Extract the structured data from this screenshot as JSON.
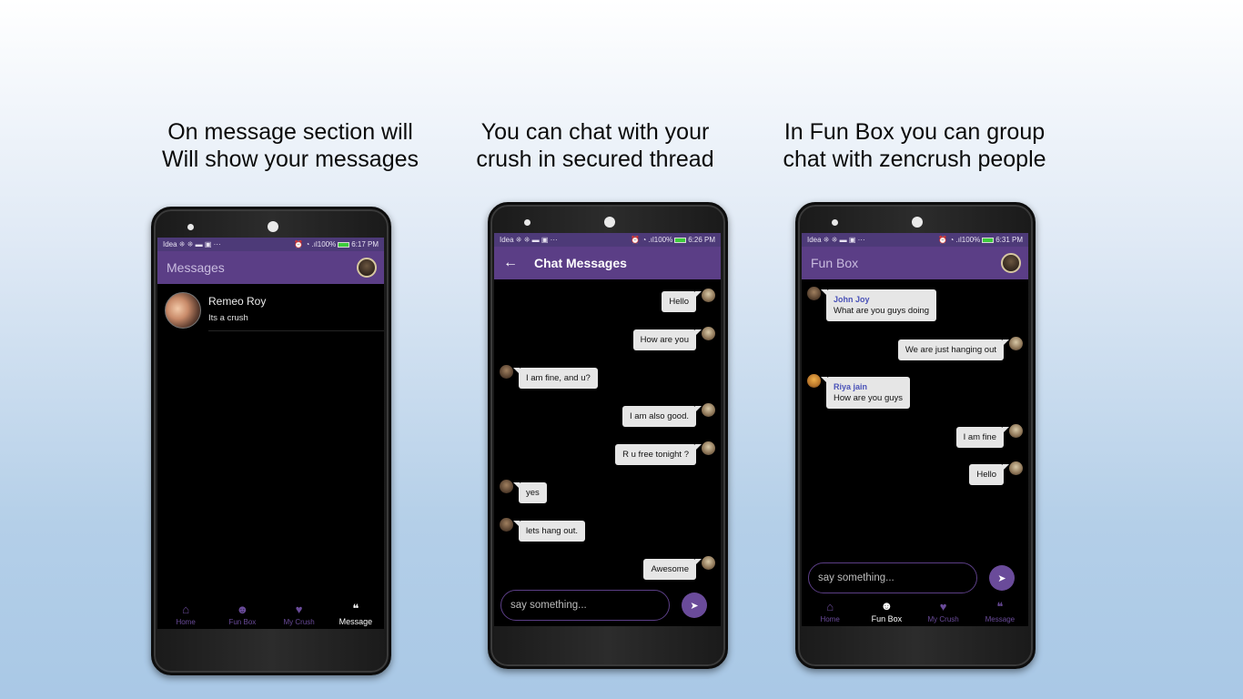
{
  "captions": [
    {
      "line1": "On message section will",
      "line2": "Will show your messages"
    },
    {
      "line1": "You can chat with your",
      "line2": "crush in secured thread"
    },
    {
      "line1": "In Fun Box you can group",
      "line2": "chat with zencrush people"
    }
  ],
  "status": {
    "carrier": "Idea ⁜ ⁜ ▬ ▣ ···",
    "signal": "⏰ ◔ .ıl100%",
    "times": [
      "6:17 PM",
      "6:26 PM",
      "6:31 PM"
    ]
  },
  "colors": {
    "accent": "#5b3e86",
    "statusbar": "#4d3a78",
    "bubble": "#e6e6e6",
    "sender": "#4a52b8"
  },
  "nav": {
    "home": "Home",
    "funbox": "Fun Box",
    "mycrush": "My Crush",
    "message": "Message",
    "icons": {
      "home": "home-icon",
      "funbox": "fun-box-icon",
      "mycrush": "heart-icon",
      "message": "chat-icon"
    }
  },
  "screen1": {
    "title": "Messages",
    "conversations": [
      {
        "name": "Remeo Roy",
        "preview": "Its a crush"
      }
    ]
  },
  "screen2": {
    "title": "Chat Messages",
    "messages": [
      {
        "side": "right",
        "text": "Hello"
      },
      {
        "side": "right",
        "text": "How are you"
      },
      {
        "side": "left",
        "text": "I am fine, and u?"
      },
      {
        "side": "right",
        "text": "I am also good."
      },
      {
        "side": "right",
        "text": "R u free tonight  ?"
      },
      {
        "side": "left",
        "text": "yes"
      },
      {
        "side": "left",
        "text": "lets hang out."
      },
      {
        "side": "right",
        "text": "Awesome"
      }
    ],
    "placeholder": "say something..."
  },
  "screen3": {
    "title": "Fun Box",
    "messages": [
      {
        "side": "left",
        "sender": "John Joy",
        "text": "What are you guys doing"
      },
      {
        "side": "right",
        "text": "We are just hanging out"
      },
      {
        "side": "left",
        "sender": "Riya jain",
        "text": "How are you guys"
      },
      {
        "side": "right",
        "text": "I am fine"
      },
      {
        "side": "right",
        "text": "Hello"
      }
    ],
    "placeholder": "say something..."
  }
}
